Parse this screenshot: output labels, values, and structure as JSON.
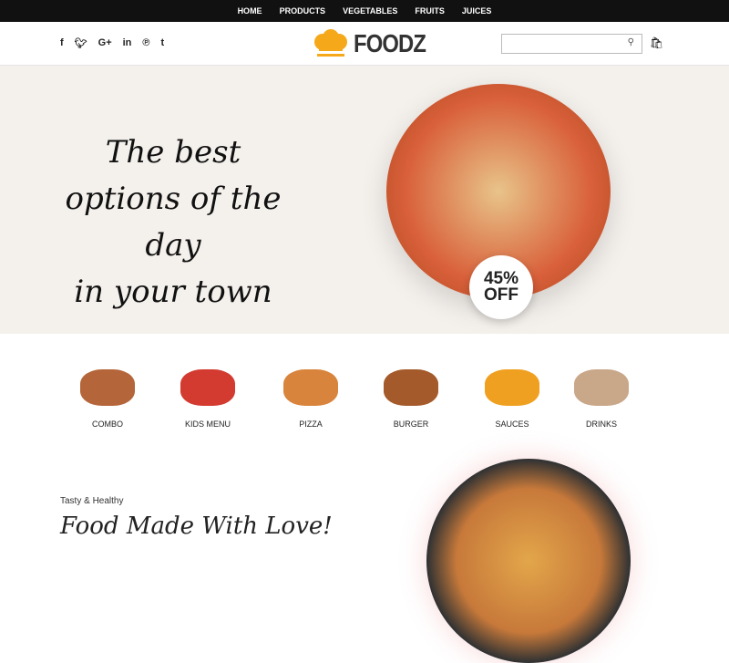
{
  "nav": [
    "HOME",
    "PRODUCTS",
    "VEGETABLES",
    "FRUITS",
    "JUICES"
  ],
  "social": [
    "f",
    "t",
    "G+",
    "in",
    "p",
    "t"
  ],
  "logo": "FOODZ",
  "search": {
    "placeholder": ""
  },
  "hero": {
    "line1": "The best",
    "line2": "options of the day",
    "line3": "in your town",
    "badge_pct": "45%",
    "badge_off": "OFF"
  },
  "categories": [
    {
      "label": "COMBO",
      "color": "#b5653a"
    },
    {
      "label": "KIDS MENU",
      "color": "#d33a30"
    },
    {
      "label": "PIZZA",
      "color": "#d9843c"
    },
    {
      "label": "BURGER",
      "color": "#a45a2a"
    },
    {
      "label": "SAUCES",
      "color": "#f0a020"
    },
    {
      "label": "DRINKS",
      "color": "#c9a88a"
    }
  ],
  "promo": {
    "tag": "Tasty & Healthy",
    "title": "Food Made With Love!"
  }
}
